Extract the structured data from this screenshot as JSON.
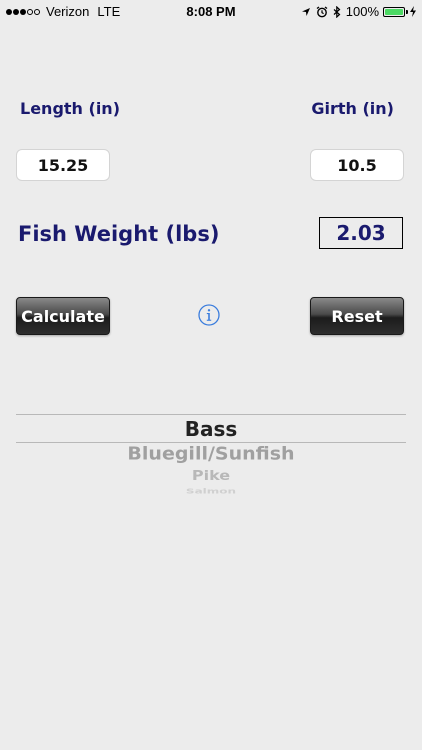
{
  "status_bar": {
    "carrier": "Verizon",
    "network": "LTE",
    "time": "8:08 PM",
    "battery_text": "100%",
    "signal_bars_filled": 3,
    "signal_bars_total": 5
  },
  "inputs": {
    "length_label": "Length (in)",
    "length_value": "15.25",
    "girth_label": "Girth (in)",
    "girth_value": "10.5"
  },
  "result": {
    "label": "Fish Weight (lbs)",
    "value": "2.03"
  },
  "buttons": {
    "calculate": "Calculate",
    "reset": "Reset"
  },
  "picker": {
    "items": [
      "Bass",
      "Bluegill/Sunfish",
      "Pike",
      "Salmon"
    ],
    "selected": "Bass"
  },
  "colors": {
    "label": "#1a1a6e",
    "background": "#ececec",
    "info_icon": "#3b7ddd",
    "battery": "#4cd964"
  },
  "icons": {
    "info": "info-icon",
    "location": "location-arrow-icon",
    "alarm": "alarm-clock-icon",
    "bluetooth": "bluetooth-icon",
    "charging": "charging-bolt-icon"
  }
}
